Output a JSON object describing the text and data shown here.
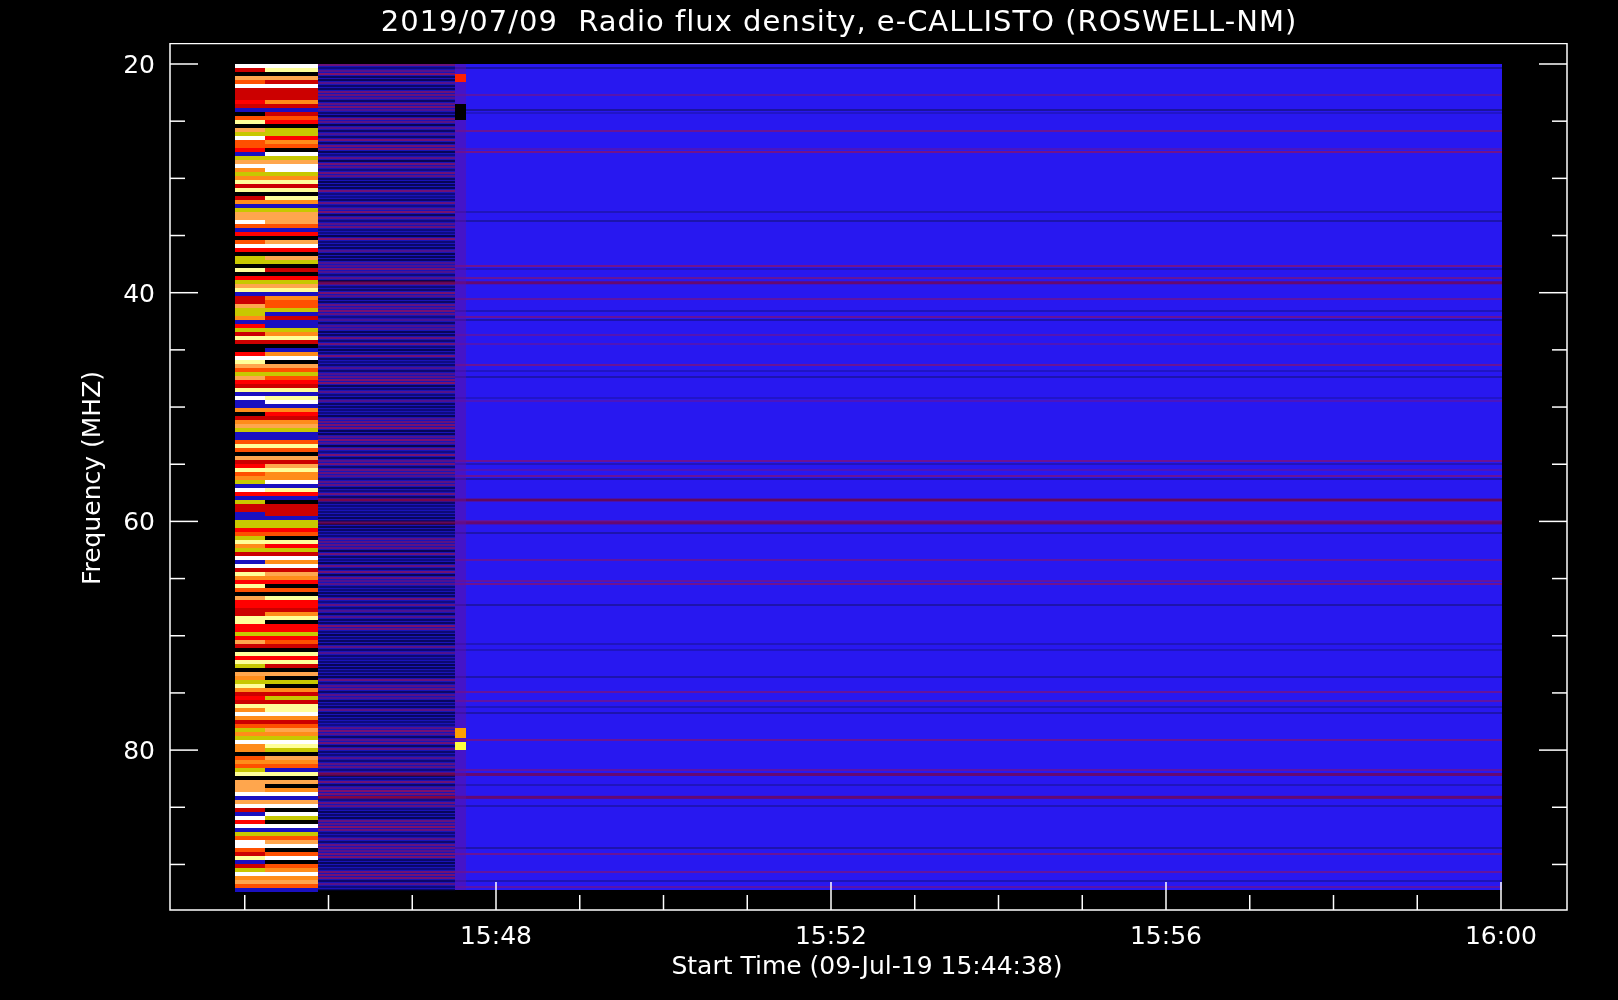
{
  "title": "2019/07/09  Radio flux density, e-CALLISTO (ROSWELL-NM)",
  "plot": {
    "ylabel": "Frequency (MHZ)",
    "yticks": [
      "20",
      "40",
      "60",
      "80"
    ],
    "xticks": [
      "15:48",
      "15:52",
      "15:56",
      "16:00"
    ],
    "xlabel": "Start Time (09-Jul-19 15:44:38)"
  }
}
